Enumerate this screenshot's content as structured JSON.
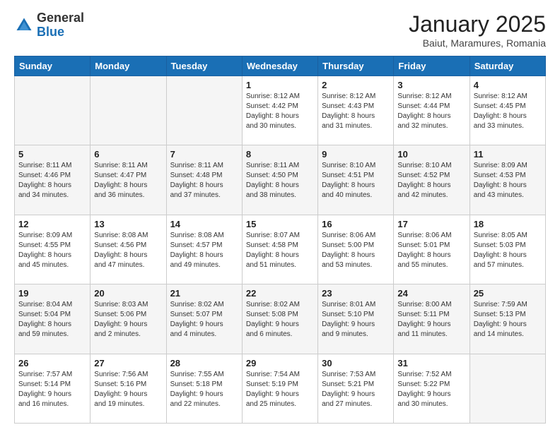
{
  "header": {
    "logo_general": "General",
    "logo_blue": "Blue",
    "month": "January 2025",
    "location": "Baiut, Maramures, Romania"
  },
  "days_of_week": [
    "Sunday",
    "Monday",
    "Tuesday",
    "Wednesday",
    "Thursday",
    "Friday",
    "Saturday"
  ],
  "weeks": [
    [
      {
        "day": "",
        "info": ""
      },
      {
        "day": "",
        "info": ""
      },
      {
        "day": "",
        "info": ""
      },
      {
        "day": "1",
        "info": "Sunrise: 8:12 AM\nSunset: 4:42 PM\nDaylight: 8 hours\nand 30 minutes."
      },
      {
        "day": "2",
        "info": "Sunrise: 8:12 AM\nSunset: 4:43 PM\nDaylight: 8 hours\nand 31 minutes."
      },
      {
        "day": "3",
        "info": "Sunrise: 8:12 AM\nSunset: 4:44 PM\nDaylight: 8 hours\nand 32 minutes."
      },
      {
        "day": "4",
        "info": "Sunrise: 8:12 AM\nSunset: 4:45 PM\nDaylight: 8 hours\nand 33 minutes."
      }
    ],
    [
      {
        "day": "5",
        "info": "Sunrise: 8:11 AM\nSunset: 4:46 PM\nDaylight: 8 hours\nand 34 minutes."
      },
      {
        "day": "6",
        "info": "Sunrise: 8:11 AM\nSunset: 4:47 PM\nDaylight: 8 hours\nand 36 minutes."
      },
      {
        "day": "7",
        "info": "Sunrise: 8:11 AM\nSunset: 4:48 PM\nDaylight: 8 hours\nand 37 minutes."
      },
      {
        "day": "8",
        "info": "Sunrise: 8:11 AM\nSunset: 4:50 PM\nDaylight: 8 hours\nand 38 minutes."
      },
      {
        "day": "9",
        "info": "Sunrise: 8:10 AM\nSunset: 4:51 PM\nDaylight: 8 hours\nand 40 minutes."
      },
      {
        "day": "10",
        "info": "Sunrise: 8:10 AM\nSunset: 4:52 PM\nDaylight: 8 hours\nand 42 minutes."
      },
      {
        "day": "11",
        "info": "Sunrise: 8:09 AM\nSunset: 4:53 PM\nDaylight: 8 hours\nand 43 minutes."
      }
    ],
    [
      {
        "day": "12",
        "info": "Sunrise: 8:09 AM\nSunset: 4:55 PM\nDaylight: 8 hours\nand 45 minutes."
      },
      {
        "day": "13",
        "info": "Sunrise: 8:08 AM\nSunset: 4:56 PM\nDaylight: 8 hours\nand 47 minutes."
      },
      {
        "day": "14",
        "info": "Sunrise: 8:08 AM\nSunset: 4:57 PM\nDaylight: 8 hours\nand 49 minutes."
      },
      {
        "day": "15",
        "info": "Sunrise: 8:07 AM\nSunset: 4:58 PM\nDaylight: 8 hours\nand 51 minutes."
      },
      {
        "day": "16",
        "info": "Sunrise: 8:06 AM\nSunset: 5:00 PM\nDaylight: 8 hours\nand 53 minutes."
      },
      {
        "day": "17",
        "info": "Sunrise: 8:06 AM\nSunset: 5:01 PM\nDaylight: 8 hours\nand 55 minutes."
      },
      {
        "day": "18",
        "info": "Sunrise: 8:05 AM\nSunset: 5:03 PM\nDaylight: 8 hours\nand 57 minutes."
      }
    ],
    [
      {
        "day": "19",
        "info": "Sunrise: 8:04 AM\nSunset: 5:04 PM\nDaylight: 8 hours\nand 59 minutes."
      },
      {
        "day": "20",
        "info": "Sunrise: 8:03 AM\nSunset: 5:06 PM\nDaylight: 9 hours\nand 2 minutes."
      },
      {
        "day": "21",
        "info": "Sunrise: 8:02 AM\nSunset: 5:07 PM\nDaylight: 9 hours\nand 4 minutes."
      },
      {
        "day": "22",
        "info": "Sunrise: 8:02 AM\nSunset: 5:08 PM\nDaylight: 9 hours\nand 6 minutes."
      },
      {
        "day": "23",
        "info": "Sunrise: 8:01 AM\nSunset: 5:10 PM\nDaylight: 9 hours\nand 9 minutes."
      },
      {
        "day": "24",
        "info": "Sunrise: 8:00 AM\nSunset: 5:11 PM\nDaylight: 9 hours\nand 11 minutes."
      },
      {
        "day": "25",
        "info": "Sunrise: 7:59 AM\nSunset: 5:13 PM\nDaylight: 9 hours\nand 14 minutes."
      }
    ],
    [
      {
        "day": "26",
        "info": "Sunrise: 7:57 AM\nSunset: 5:14 PM\nDaylight: 9 hours\nand 16 minutes."
      },
      {
        "day": "27",
        "info": "Sunrise: 7:56 AM\nSunset: 5:16 PM\nDaylight: 9 hours\nand 19 minutes."
      },
      {
        "day": "28",
        "info": "Sunrise: 7:55 AM\nSunset: 5:18 PM\nDaylight: 9 hours\nand 22 minutes."
      },
      {
        "day": "29",
        "info": "Sunrise: 7:54 AM\nSunset: 5:19 PM\nDaylight: 9 hours\nand 25 minutes."
      },
      {
        "day": "30",
        "info": "Sunrise: 7:53 AM\nSunset: 5:21 PM\nDaylight: 9 hours\nand 27 minutes."
      },
      {
        "day": "31",
        "info": "Sunrise: 7:52 AM\nSunset: 5:22 PM\nDaylight: 9 hours\nand 30 minutes."
      },
      {
        "day": "",
        "info": ""
      }
    ]
  ]
}
